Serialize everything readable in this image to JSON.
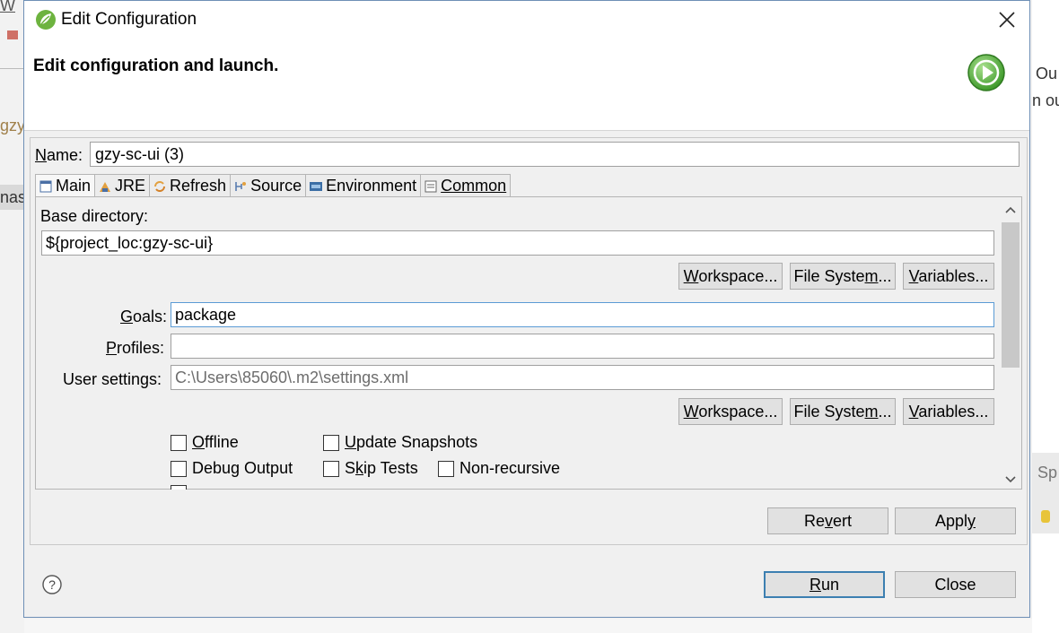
{
  "background": {
    "left_fragments": [
      "W",
      "gzy",
      "nast"
    ],
    "right_fragments": [
      "Ou",
      "n ou",
      "Sp"
    ]
  },
  "dialog": {
    "title": "Edit Configuration",
    "header_title": "Edit configuration and launch.",
    "name": {
      "label_key": "N",
      "label_rest": "ame:",
      "value": "gzy-sc-ui (3)"
    },
    "tabs": [
      {
        "label": "Main",
        "icon": "main-tab-icon",
        "active": true
      },
      {
        "label": "JRE",
        "icon": "jre-icon"
      },
      {
        "label": "Refresh",
        "icon": "refresh-icon"
      },
      {
        "label": "Source",
        "icon": "source-icon"
      },
      {
        "label": "Environment",
        "icon": "environment-icon"
      },
      {
        "label": "Common",
        "icon": "common-icon"
      }
    ],
    "main": {
      "base_directory_label": "Base directory:",
      "base_directory_value": "${project_loc:gzy-sc-ui}",
      "goals_label_key": "G",
      "goals_label_rest": "oals:",
      "goals_value": "package",
      "profiles_label_key": "P",
      "profiles_label_rest": "rofiles:",
      "profiles_value": "",
      "user_settings_label": "User settings:",
      "user_settings_value": "C:\\Users\\85060\\.m2\\settings.xml",
      "workspace_key": "W",
      "workspace_rest": "orkspace...",
      "filesystem_pre": "File Syste",
      "filesystem_key": "m",
      "filesystem_post": "...",
      "variables_key": "V",
      "variables_rest": "ariables...",
      "checkboxes": {
        "offline_key": "O",
        "offline_rest": "ffline",
        "update_key": "U",
        "update_rest": "pdate Snapshots",
        "debug_pre": "Debu",
        "debug_key": "g",
        "debug_post": " Output",
        "skip_pre": "S",
        "skip_key": "k",
        "skip_post": "ip Tests",
        "nonrec": "Non-recursive"
      }
    },
    "revert_pre": "Re",
    "revert_key": "v",
    "revert_post": "ert",
    "apply_pre": "Appl",
    "apply_key": "y",
    "run_key": "R",
    "run_rest": "un",
    "close_label": "Close",
    "colors": {
      "border": "#6e8fb6",
      "focus": "#5b9bd5",
      "default_button": "#3c7fb1",
      "run_icon": "#4caf3a"
    }
  }
}
